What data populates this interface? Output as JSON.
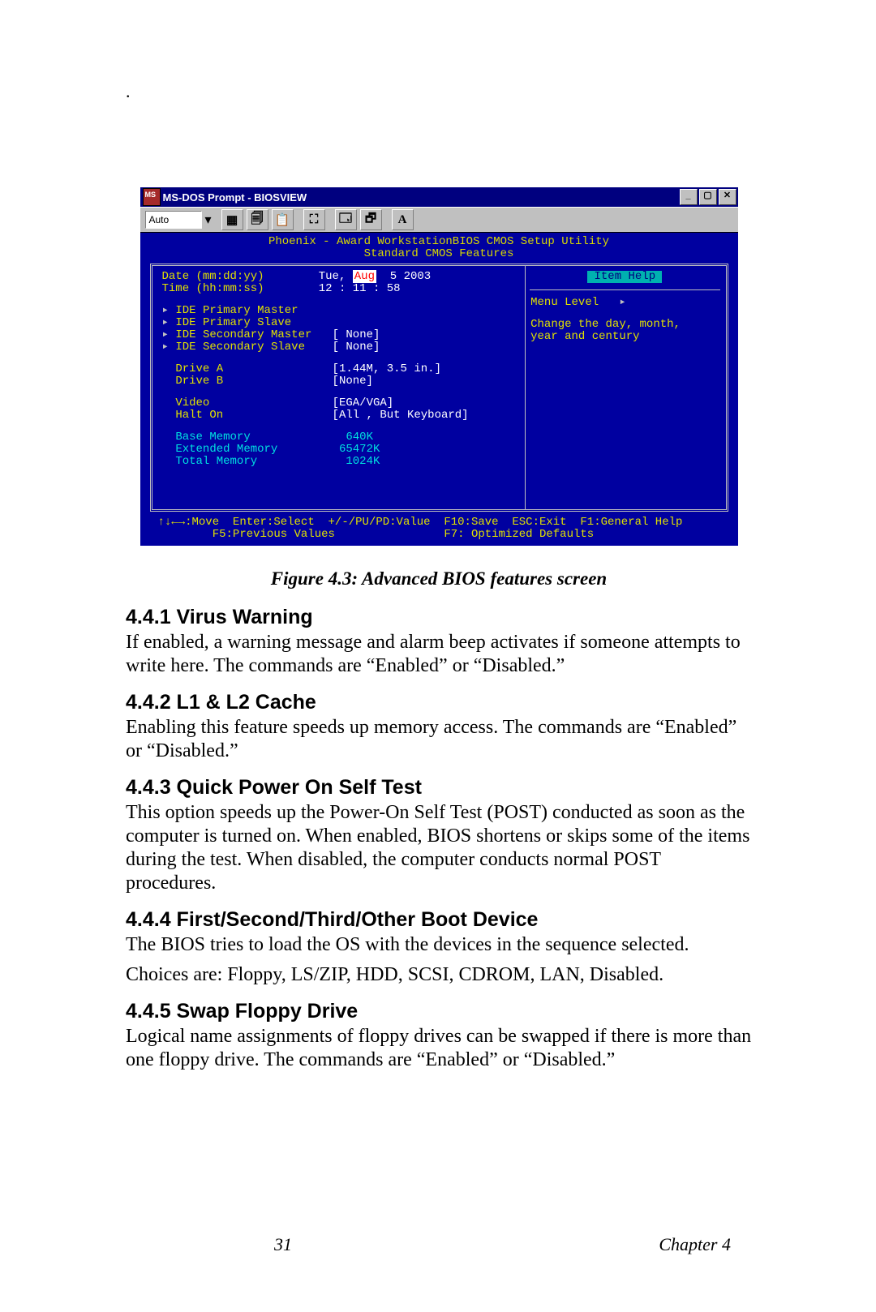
{
  "window": {
    "title": "MS-DOS Prompt - BIOSVIEW",
    "btn_min": "_",
    "btn_max": "▢",
    "btn_close": "✕",
    "auto": "Auto",
    "a_btn": "A"
  },
  "bios": {
    "head1": "Phoenix - Award WorkstationBIOS CMOS Setup Utility",
    "head2": "Standard CMOS Features",
    "rows": {
      "date_lbl": "Date (mm:dd:yy)",
      "date_pre": "Tue, ",
      "date_month": "Aug",
      "date_rest": "  5 2003",
      "time_lbl": "Time (hh:mm:ss)",
      "time_val": "12 : 11 : 58",
      "ide_pm": "IDE Primary Master",
      "ide_ps": "IDE Primary Slave",
      "ide_sm": "IDE Secondary Master",
      "ide_sm_v": "[ None]",
      "ide_ss": "IDE Secondary Slave",
      "ide_ss_v": "[ None]",
      "drva": "Drive A",
      "drva_v": "[1.44M, 3.5 in.]",
      "drvb": "Drive B",
      "drvb_v": "[None]",
      "video": "Video",
      "video_v": "[EGA/VGA]",
      "halt": "Halt On",
      "halt_v": "[All , But Keyboard]",
      "base": "Base Memory",
      "base_v": "640K",
      "ext": "Extended Memory",
      "ext_v": "65472K",
      "tot": "Total Memory",
      "tot_v": "1024K"
    },
    "help": {
      "title": "Item Help",
      "menu": "Menu Level",
      "arrow": "▸",
      "body": "Change the day, month,\nyear and century"
    },
    "foot1": "↑↓←→:Move  Enter:Select  +/-/PU/PD:Value  F10:Save  ESC:Exit  F1:General Help",
    "foot2": "        F5:Previous Values                F7: Optimized Defaults"
  },
  "caption": "Figure 4.3: Advanced BIOS features screen",
  "sec": {
    "s1h": "4.4.1 Virus Warning",
    "s1p": "If enabled, a warning message and alarm beep activates if someone attempts to write here. The commands are “Enabled” or “Disabled.”",
    "s2h": "4.4.2 L1 & L2 Cache",
    "s2p": "Enabling this feature speeds up memory access. The commands are “Enabled” or “Disabled.”",
    "s3h": "4.4.3 Quick Power On Self Test",
    "s3p": "This option speeds up the Power-On Self Test (POST) conducted as soon as the computer is turned on. When enabled, BIOS shortens or skips some of the items during the test. When disabled, the computer conducts normal POST procedures.",
    "s4h": "4.4.4 First/Second/Third/Other Boot Device",
    "s4p1": "The BIOS tries to load the OS with the devices in the sequence selected.",
    "s4p2": "Choices are: Floppy, LS/ZIP, HDD, SCSI, CDROM, LAN, Disabled.",
    "s5h": "4.4.5 Swap Floppy Drive",
    "s5p": "Logical name assignments of floppy drives can be swapped if there is more than one floppy drive. The commands are “Enabled” or “Disabled.”"
  },
  "footer": {
    "page": "31",
    "chapter": "Chapter 4"
  }
}
